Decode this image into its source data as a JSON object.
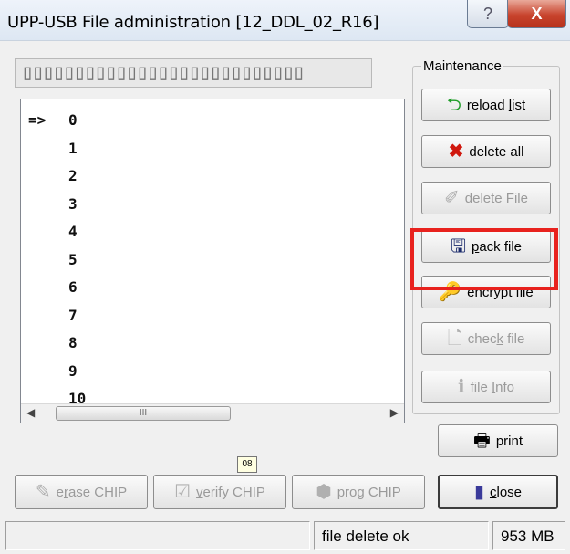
{
  "window": {
    "title": "UPP-USB File administration [12_DDL_02_R16]",
    "help_label": "?",
    "close_label": "X"
  },
  "code_box": {
    "text": "▯▯▯▯▯▯▯▯▯▯▯▯▯▯▯▯▯▯▯▯▯▯▯▯▯▯▯"
  },
  "list": {
    "marker": "=>",
    "items": [
      "0",
      "1",
      "2",
      "3",
      "4",
      "5",
      "6",
      "7",
      "8",
      "9",
      "10"
    ],
    "scroll_thumb": "III"
  },
  "maintenance": {
    "label": "Maintenance",
    "reload": {
      "pre": "reload ",
      "u": "l",
      "post": "ist"
    },
    "delete_all": {
      "label": "delete all"
    },
    "delete_file": {
      "label": "delete File"
    },
    "pack_file": {
      "pre": "",
      "u": "p",
      "post": "ack file"
    },
    "encrypt_file": {
      "pre": "",
      "u": "e",
      "post": "ncrypt file"
    },
    "check_file": {
      "pre": "chec",
      "u": "k",
      "post": " file"
    },
    "file_info": {
      "pre": "file ",
      "u": "I",
      "post": "nfo"
    }
  },
  "print": {
    "label": "print"
  },
  "close": {
    "pre": "",
    "u": "c",
    "post": "lose"
  },
  "bottom_buttons": {
    "erase": {
      "pre": "e",
      "u": "r",
      "post": "ase CHIP"
    },
    "verify": {
      "pre": "",
      "u": "v",
      "post": "erify CHIP"
    },
    "prog": {
      "pre": "pro",
      "u": "g",
      "post": " CHIP"
    }
  },
  "tooltip": {
    "text": "08"
  },
  "status": {
    "message": "file delete ok",
    "size": "953 MB"
  },
  "colors": {
    "highlight": "#e8221e"
  }
}
